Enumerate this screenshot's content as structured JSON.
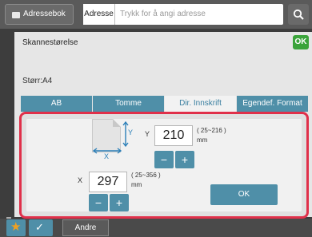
{
  "topbar": {
    "address_book_label": "Adressebok",
    "address_tag": "Adresse",
    "address_placeholder": "Trykk for å angi adresse"
  },
  "panel": {
    "title": "Skannestørelse",
    "ok_label": "OK",
    "size_line": "Størr:A4",
    "tabs": [
      "AB",
      "Tomme",
      "Dir. Innskrift",
      "Egendef. Format"
    ],
    "active_tab": 2
  },
  "dialog": {
    "y_label": "Y",
    "y_value": "210",
    "y_range": "( 25~216 )",
    "y_unit": "mm",
    "x_label": "X",
    "x_value": "297",
    "x_range": "( 25~356 )",
    "x_unit": "mm",
    "minus": "−",
    "plus": "+",
    "ok_label": "OK"
  },
  "bottombar": {
    "other_label": "Andre"
  },
  "colors": {
    "accent": "#4f8fa8",
    "highlight": "#e0304a",
    "ok_green": "#3aa33a",
    "star": "#f0a020"
  }
}
